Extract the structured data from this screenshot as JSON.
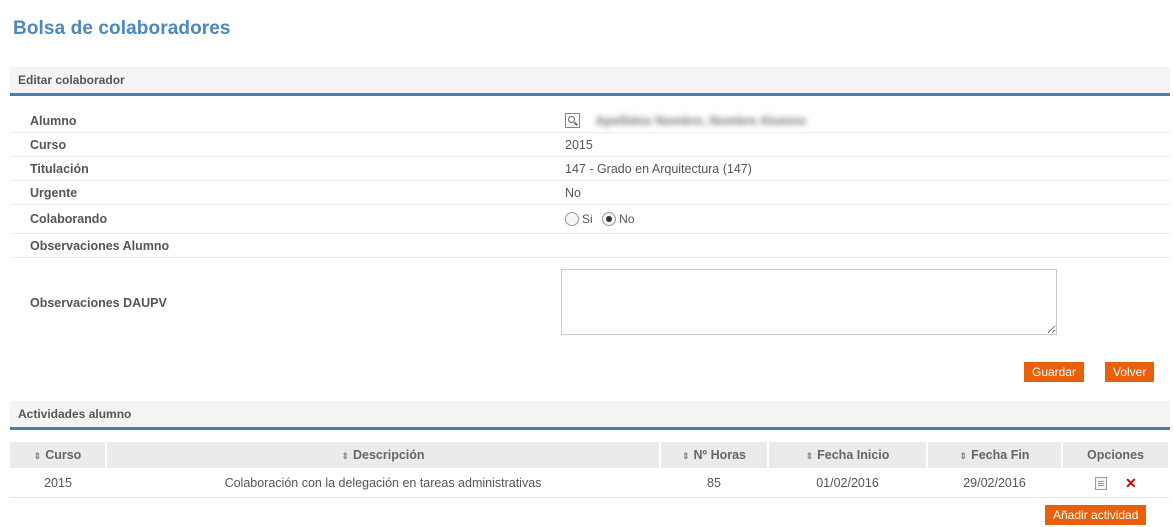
{
  "page_title": "Bolsa de colaboradores",
  "edit_section": {
    "title": "Editar colaborador",
    "fields": {
      "alumno_label": "Alumno",
      "alumno_value": "Apellidos Nombre, Nombre Alumno",
      "curso_label": "Curso",
      "curso_value": "2015",
      "titulacion_label": "Titulación",
      "titulacion_value": "147 - Grado en Arquitectura (147)",
      "urgente_label": "Urgente",
      "urgente_value": "No",
      "colaborando_label": "Colaborando",
      "colaborando_options": [
        "Si",
        "No"
      ],
      "colaborando_selected": "No",
      "obs_alumno_label": "Observaciones Alumno",
      "obs_alumno_value": "",
      "obs_daupv_label": "Observaciones DAUPV",
      "obs_daupv_value": ""
    },
    "buttons": {
      "save": "Guardar",
      "back": "Volver"
    }
  },
  "activities_section": {
    "title": "Actividades alumno",
    "columns": [
      "Curso",
      "Descripción",
      "Nº Horas",
      "Fecha Inicio",
      "Fecha Fin",
      "Opciones"
    ],
    "rows": [
      {
        "curso": "2015",
        "descripcion": "Colaboración con la delegación en tareas administrativas",
        "horas": "85",
        "fecha_inicio": "01/02/2016",
        "fecha_fin": "29/02/2016"
      }
    ],
    "add_button": "Añadir actividad"
  },
  "colors": {
    "accent": "#4a88bd",
    "button": "#e8600b",
    "header_line": "#4a7ab8"
  }
}
